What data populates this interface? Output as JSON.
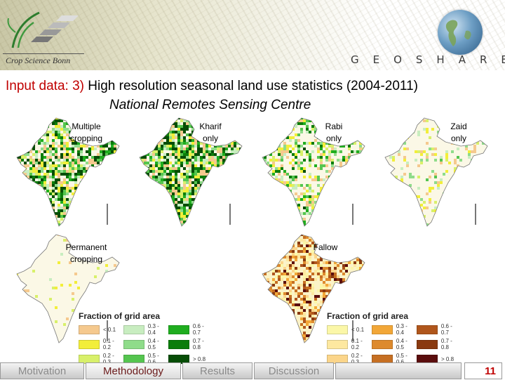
{
  "header": {
    "logo_text": "Crop Science Bonn",
    "brand": "GEOSHARE"
  },
  "title": {
    "prefix": "Input data:",
    "number": "3)",
    "text": "High resolution seasonal land use statistics (2004-2011)",
    "subtitle": "National Remotes Sensing Centre"
  },
  "maps": [
    {
      "label": "Multiple\ncropping",
      "palette": "green",
      "intensity": 0.75
    },
    {
      "label": "Kharif\nonly",
      "palette": "green",
      "intensity": 0.85
    },
    {
      "label": "Rabi\nonly",
      "palette": "green",
      "intensity": 0.5
    },
    {
      "label": "Zaid\nonly",
      "palette": "green",
      "intensity": 0.2
    },
    {
      "label": "Permanent\ncropping",
      "palette": "green",
      "intensity": 0.05
    },
    {
      "label": "Fallow",
      "palette": "brown",
      "intensity": 0.6
    }
  ],
  "legend_green": {
    "title": "Fraction of grid area",
    "items": [
      {
        "label": "< 0.1",
        "color": "#f5c98e"
      },
      {
        "label": "0.3 - 0.4",
        "color": "#c8edc0"
      },
      {
        "label": "0.6 - 0.7",
        "color": "#1fad1f"
      },
      {
        "label": "0.1 - 0.2",
        "color": "#f2ee3a"
      },
      {
        "label": "0.4 - 0.5",
        "color": "#8fdc8a"
      },
      {
        "label": "0.7 - 0.8",
        "color": "#0b7d0b"
      },
      {
        "label": "0.2 - 0.3",
        "color": "#d8f06a"
      },
      {
        "label": "0.5 - 0.6",
        "color": "#55c54f"
      },
      {
        "label": "> 0.8",
        "color": "#064d06"
      }
    ]
  },
  "legend_brown": {
    "title": "Fraction of grid area",
    "items": [
      {
        "label": "< 0.1",
        "color": "#fbf7a8"
      },
      {
        "label": "0.3 - 0.4",
        "color": "#f2a738"
      },
      {
        "label": "0.6 - 0.7",
        "color": "#b0561c"
      },
      {
        "label": "0.1 - 0.2",
        "color": "#fde8a0"
      },
      {
        "label": "0.4 - 0.5",
        "color": "#dd8a2e"
      },
      {
        "label": "0.7 - 0.8",
        "color": "#8a3a10"
      },
      {
        "label": "0.2 - 0.3",
        "color": "#fbd58a"
      },
      {
        "label": "0.5 - 0.6",
        "color": "#c66f22"
      },
      {
        "label": "> 0.8",
        "color": "#5a0d0d"
      }
    ]
  },
  "footer": {
    "tabs": [
      {
        "label": "Motivation",
        "active": false
      },
      {
        "label": "Methodology",
        "active": true
      },
      {
        "label": "Results",
        "active": false
      },
      {
        "label": "Discussion",
        "active": false
      }
    ],
    "page_number": "11"
  }
}
